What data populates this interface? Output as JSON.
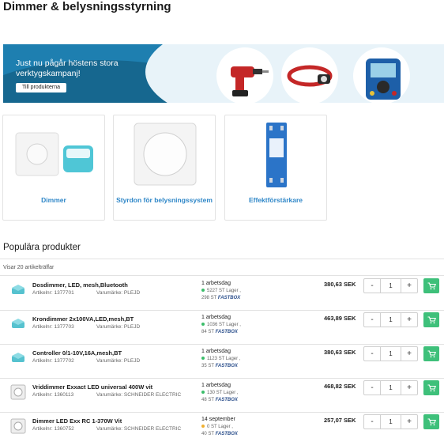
{
  "page": {
    "title": "Dimmer & belysningsstyrning"
  },
  "banner": {
    "text": "Just nu pågår höstens stora verktygskampanj!",
    "button_label": "Till produkterna",
    "images": [
      "drill-icon",
      "headlamp-icon",
      "multimeter-icon"
    ],
    "bg_color": "#1e7fb0"
  },
  "categories": [
    {
      "label": "Dimmer",
      "icon": "dimmer-icon"
    },
    {
      "label": "Styrdon för belysningssystem",
      "icon": "control-panel-icon"
    },
    {
      "label": "Effektförstärkare",
      "icon": "din-module-icon"
    }
  ],
  "popular": {
    "title": "Populära produkter",
    "hits_label": "Visar 20 artikelträffar"
  },
  "products": [
    {
      "name": "Dosdimmer, LED, mesh,Bluetooth",
      "article": "Artikelnr: 1377701",
      "brand": "Varumärke: PLEJD",
      "delivery": "1 arbetsdag",
      "stock": "5227 ST Lager ,",
      "fastbox": "298 ST",
      "fastbox_label": "FASTBOX",
      "price": "380,63 SEK",
      "qty": "1",
      "status": "in-stock"
    },
    {
      "name": "Krondimmer 2x100VA,LED,mesh,BT",
      "article": "Artikelnr: 1377703",
      "brand": "Varumärke: PLEJD",
      "delivery": "1 arbetsdag",
      "stock": "1036 ST Lager ,",
      "fastbox": "84 ST",
      "fastbox_label": "FASTBOX",
      "price": "463,89 SEK",
      "qty": "1",
      "status": "in-stock"
    },
    {
      "name": "Controller 0/1-10V,16A,mesh,BT",
      "article": "Artikelnr: 1377702",
      "brand": "Varumärke: PLEJD",
      "delivery": "1 arbetsdag",
      "stock": "1123 ST Lager ,",
      "fastbox": "35 ST",
      "fastbox_label": "FASTBOX",
      "price": "380,63 SEK",
      "qty": "1",
      "status": "in-stock"
    },
    {
      "name": "Vriddimmer Exxact LED universal 400W vit",
      "article": "Artikelnr: 1360113",
      "brand": "Varumärke: SCHNEIDER ELECTRIC",
      "delivery": "1 arbetsdag",
      "stock": "130 ST Lager ,",
      "fastbox": "48 ST",
      "fastbox_label": "FASTBOX",
      "price": "468,82 SEK",
      "qty": "1",
      "status": "in-stock"
    },
    {
      "name": "Dimmer LED Exx RC 1-370W Vit",
      "article": "Artikelnr: 1360752",
      "brand": "Varumärke: SCHNEIDER ELECTRIC",
      "delivery": "14 september",
      "stock": "0 ST Lager ,",
      "fastbox": "40 ST",
      "fastbox_label": "FASTBOX",
      "price": "257,07 SEK",
      "qty": "1",
      "status": "low"
    }
  ],
  "stepper": {
    "minus": "-",
    "plus": "+"
  },
  "colors": {
    "accent": "#2f87c8",
    "cart": "#3ec07a",
    "fastbox": "#2b4f8c"
  }
}
